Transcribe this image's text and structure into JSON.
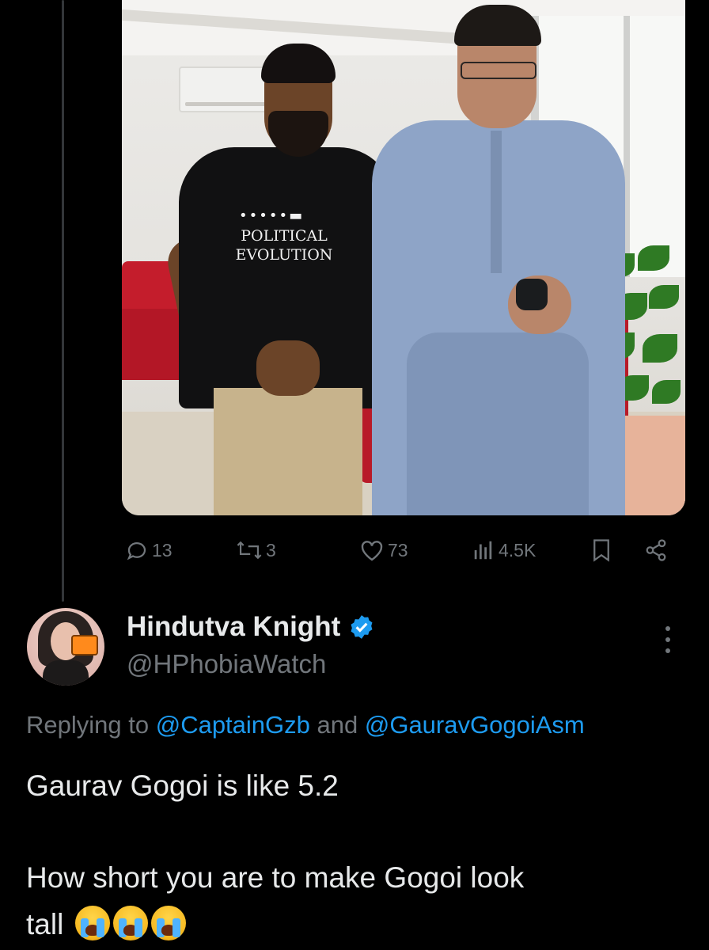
{
  "quoted_tweet": {
    "photo_shirt_text": [
      "POLITICAL",
      "EVOLUTION"
    ],
    "actions": {
      "replies": "13",
      "reposts": "3",
      "likes": "73",
      "views": "4.5K"
    }
  },
  "reply": {
    "display_name": "Hindutva Knight",
    "handle": "@HPhobiaWatch",
    "verified": true,
    "replying_prefix": "Replying to ",
    "mention_1": "@CaptainGzb",
    "replying_and": " and ",
    "mention_2": "@GauravGogoiAsm",
    "text_line_1": "Gaurav Gogoi is like 5.2",
    "text_line_2": "How short you are to make Gogoi look",
    "text_line_3": "tall",
    "emoji": "loudly-crying-face",
    "emoji_count": 3
  },
  "colors": {
    "background": "#000000",
    "text": "#e7e9ea",
    "muted": "#71767b",
    "accent": "#1d9bf0"
  }
}
